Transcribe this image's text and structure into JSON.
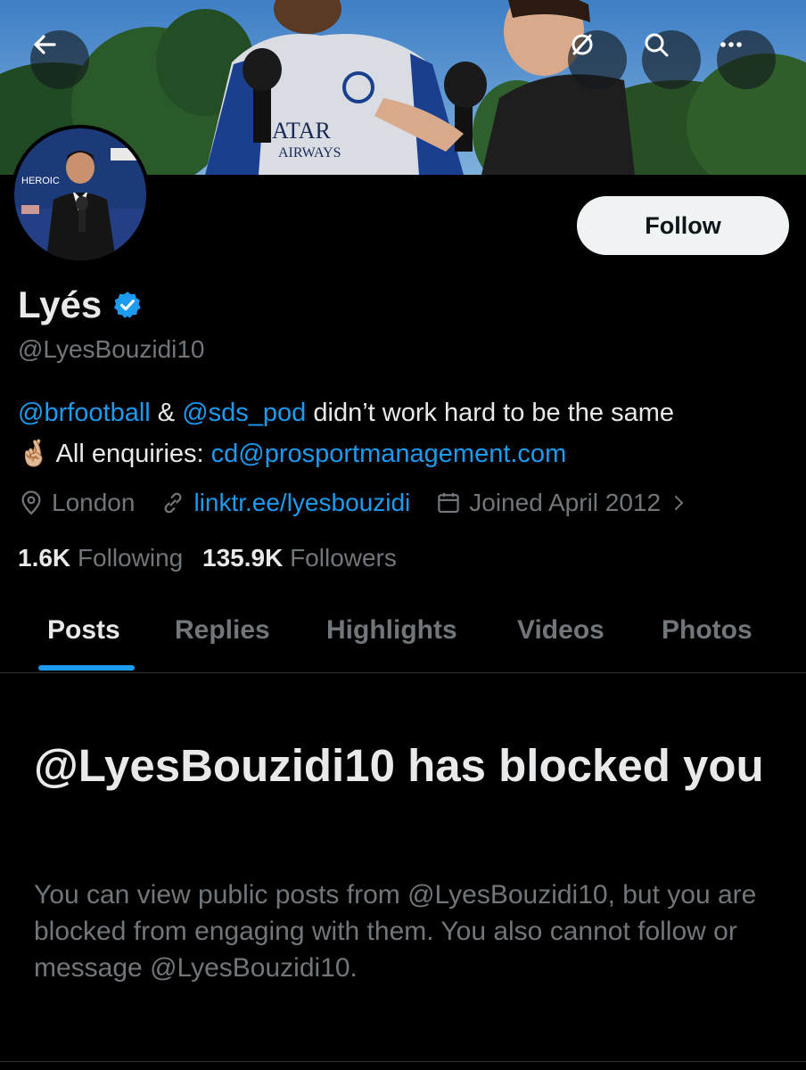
{
  "header": {
    "back_icon": "arrow-left-icon",
    "actions": [
      {
        "name": "hide-icon",
        "label": "Hide"
      },
      {
        "name": "search-icon",
        "label": "Search"
      },
      {
        "name": "more-icon",
        "label": "More"
      }
    ],
    "banner_text": "ATAR\nAIRWAYS"
  },
  "profile": {
    "display_name": "Lyés",
    "verified": true,
    "handle": "@LyesBouzidi10",
    "follow_label": "Follow",
    "bio": {
      "mention1": "@brfootball",
      "amp": " & ",
      "mention2": "@sds_pod",
      "text1": " didn’t work hard to be the same",
      "emoji": "🤞🏼",
      "text2": " All enquiries: ",
      "email": "cd@prosportmanagement.com"
    },
    "location": "London",
    "website": "linktr.ee/lyesbouzidi",
    "joined": "Joined April 2012",
    "following_count": "1.6K",
    "following_label": "Following",
    "followers_count": "135.9K",
    "followers_label": "Followers"
  },
  "tabs": [
    {
      "label": "Posts",
      "active": true
    },
    {
      "label": "Replies",
      "active": false
    },
    {
      "label": "Highlights",
      "active": false
    },
    {
      "label": "Videos",
      "active": false
    },
    {
      "label": "Photos",
      "active": false
    }
  ],
  "blocked": {
    "title": "@LyesBouzidi10 has blocked you",
    "description": "You can view public posts from @LyesBouzidi10, but you are blocked from engaging with them. You also cannot follow or message @LyesBouzidi10."
  },
  "colors": {
    "accent": "#1d9bf0",
    "background": "#000000",
    "primary_text": "#e7e9ea",
    "secondary_text": "#71767b"
  }
}
